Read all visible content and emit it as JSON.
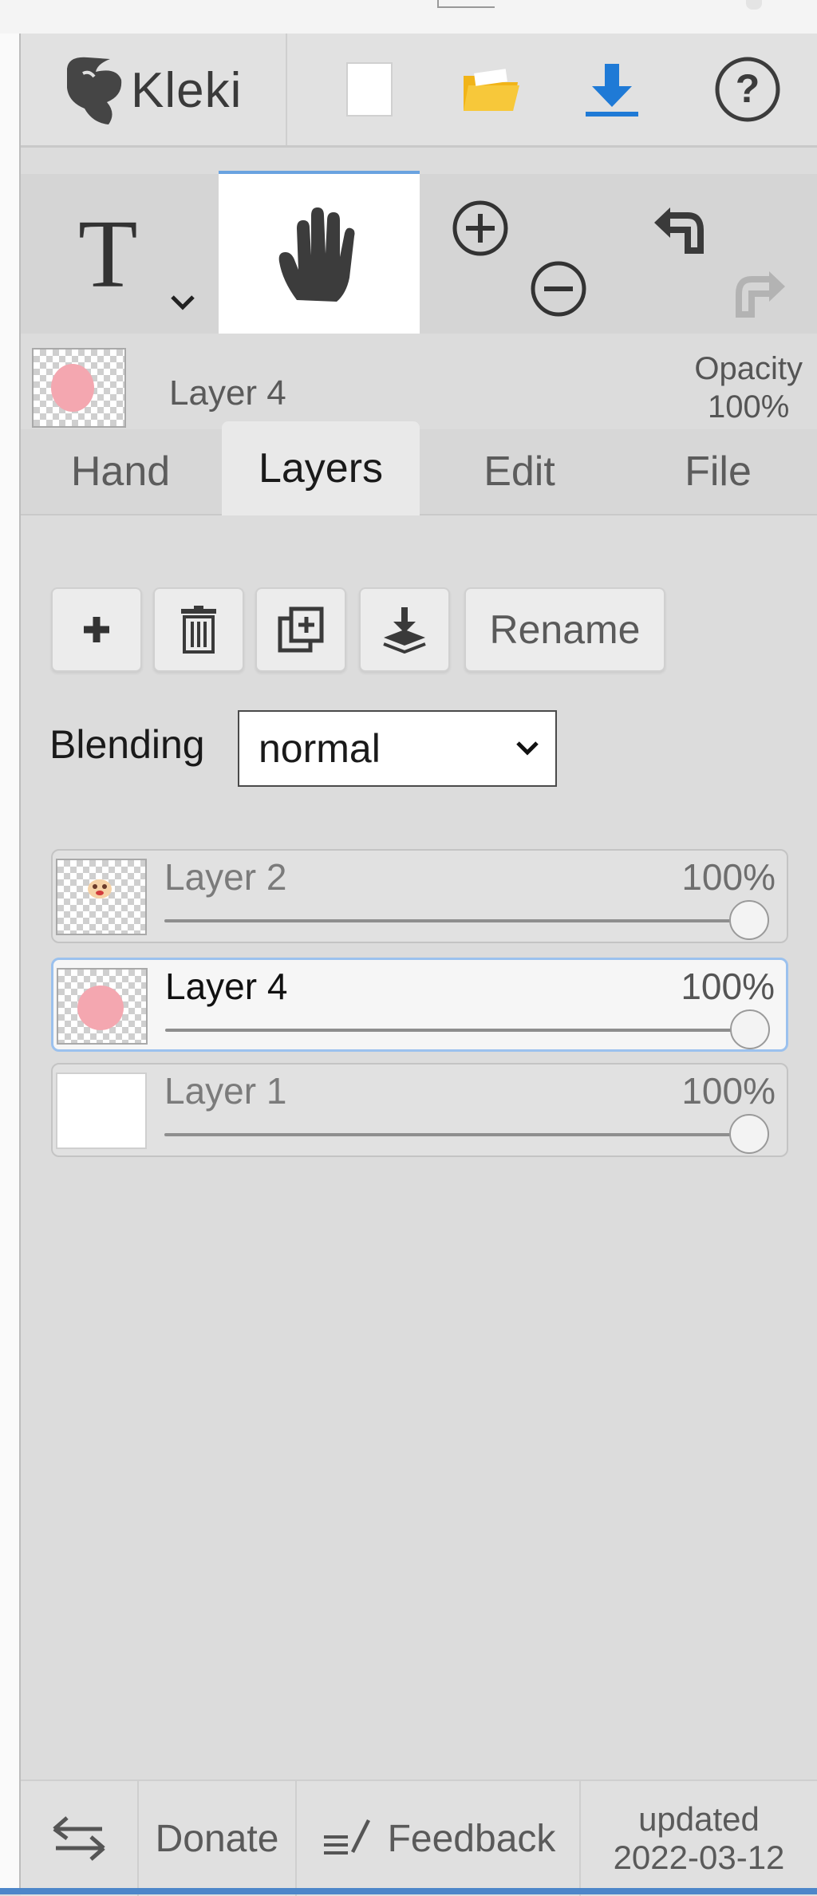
{
  "app": {
    "logo_text": "Kleki"
  },
  "header": {
    "buttons": [
      {
        "name": "new-image-button",
        "icon": "blank-page-icon"
      },
      {
        "name": "open-file-button",
        "icon": "folder-icon"
      },
      {
        "name": "save-button",
        "icon": "download-icon"
      },
      {
        "name": "help-button",
        "icon": "help-circle-icon"
      }
    ]
  },
  "tools": {
    "text_tool_glyph": "T",
    "active_tool": "hand",
    "zoom": [
      "zoom-in-icon",
      "zoom-out-icon"
    ],
    "history": [
      "undo-icon",
      "redo-icon"
    ]
  },
  "active_layer": {
    "name": "Layer 4",
    "opacity_label": "Opacity",
    "opacity_value": "100%"
  },
  "tabs": [
    {
      "label": "Hand",
      "active": false
    },
    {
      "label": "Layers",
      "active": true
    },
    {
      "label": "Edit",
      "active": false
    },
    {
      "label": "File",
      "active": false
    }
  ],
  "layers_panel": {
    "actions": [
      "add-layer-icon",
      "delete-layer-icon",
      "duplicate-layer-icon",
      "merge-down-icon"
    ],
    "rename_label": "Rename",
    "blending_label": "Blending",
    "blending_value": "normal",
    "layers": [
      {
        "name": "Layer 2",
        "opacity": "100%",
        "opacity_fraction": 1.0,
        "selected": false
      },
      {
        "name": "Layer 4",
        "opacity": "100%",
        "opacity_fraction": 1.0,
        "selected": true
      },
      {
        "name": "Layer 1",
        "opacity": "100%",
        "opacity_fraction": 1.0,
        "selected": false
      }
    ]
  },
  "footer": {
    "donate_label": "Donate",
    "feedback_label": "Feedback",
    "updated_label": "updated",
    "updated_date": "2022-03-12"
  },
  "colors": {
    "accent": "#4d86c9",
    "download_blue": "#1f7ad6",
    "folder_yellow": "#f5bd1f",
    "selected_border": "#9bc1ee"
  }
}
